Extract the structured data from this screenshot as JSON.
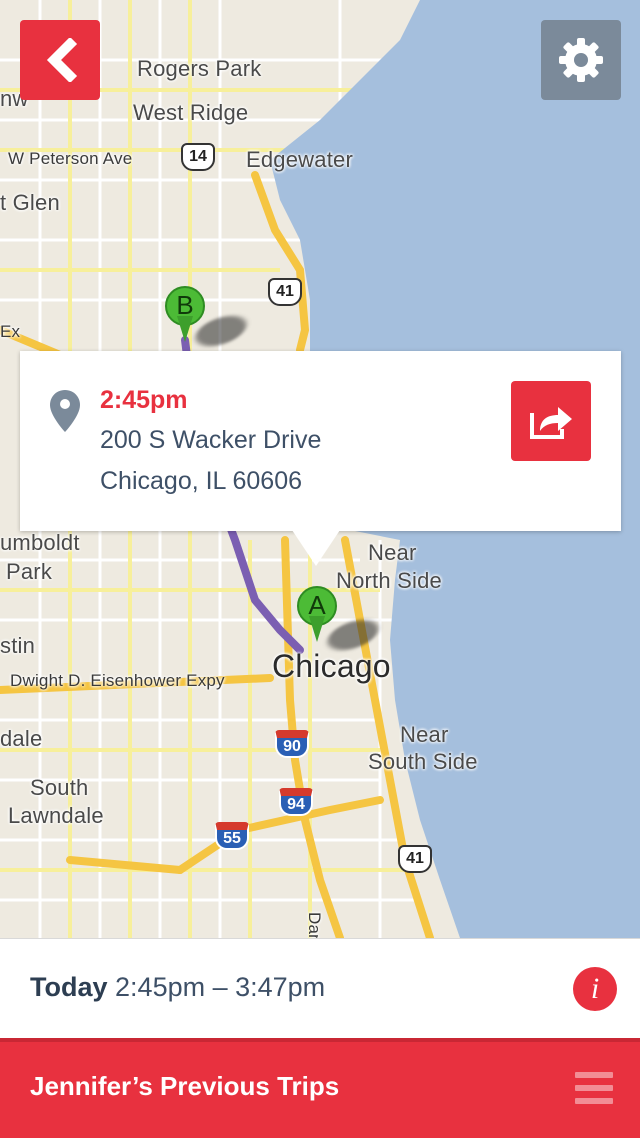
{
  "map": {
    "labels": {
      "rogers_park": "Rogers Park",
      "west_ridge": "West Ridge",
      "peterson": "W Peterson Ave",
      "edgewater": "Edgewater",
      "glen": "t Glen",
      "humboldt": "umboldt",
      "park": "Park",
      "near_north_1": "Near",
      "near_north_2": "North Side",
      "austin": "stin",
      "eisenhower": "Dwight D. Eisenhower Expy",
      "chicago": "Chicago",
      "dale": "dale",
      "near_south_1": "Near",
      "near_south_2": "South Side",
      "south_lawndale_1": "South",
      "south_lawndale_2": "Lawndale",
      "dan": "Dan",
      "nw": "nw",
      "ex": "Ex"
    },
    "shields": {
      "r14": "14",
      "r41_top": "41",
      "i90": "90",
      "i94": "94",
      "i55": "55",
      "r41_bottom": "41"
    },
    "pins": {
      "a": "A",
      "b": "B"
    }
  },
  "buttons": {
    "back_icon": "chevron-left-icon",
    "settings_icon": "gear-icon",
    "share_icon": "share-icon"
  },
  "popup": {
    "time": "2:45pm",
    "address_line1": "200 S Wacker Drive",
    "address_line2": "Chicago, IL 60606"
  },
  "trip": {
    "day": "Today",
    "range": "2:45pm – 3:47pm",
    "info_label": "i"
  },
  "footer": {
    "title": "Jennifer’s Previous Trips",
    "menu_icon": "hamburger-menu-icon"
  },
  "colors": {
    "accent": "#e8313f",
    "settings": "#7b8a9a",
    "text": "#3e5067",
    "lake": "#a5bfdd",
    "route": "#7b5fb2",
    "pin": "#4cbb36"
  }
}
